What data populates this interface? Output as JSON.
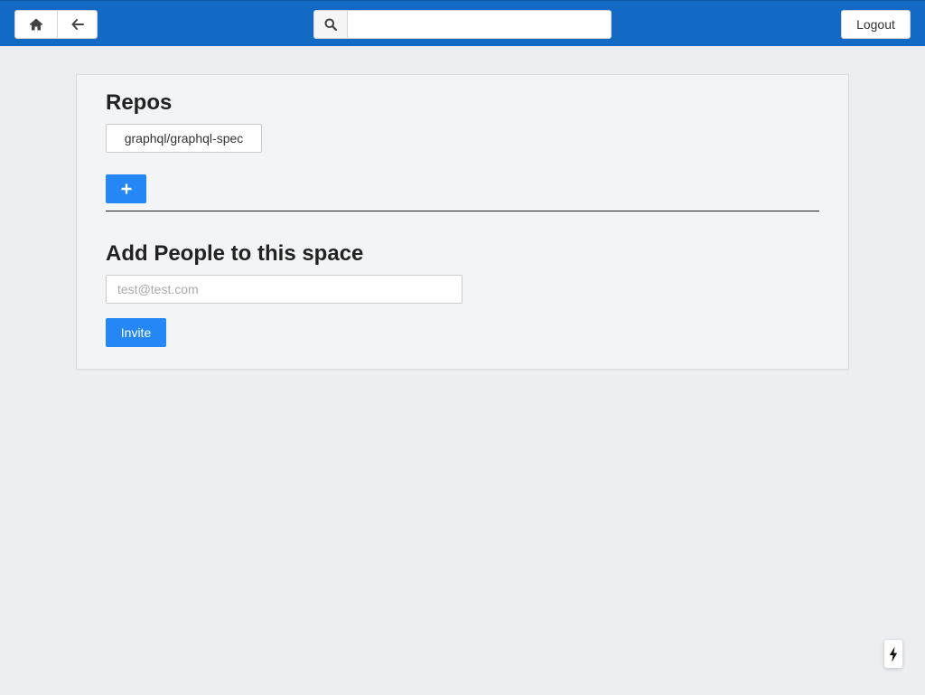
{
  "header": {
    "home_icon": "home-icon",
    "back_icon": "arrow-left-icon",
    "search_icon": "search-icon",
    "search_value": "",
    "logout_label": "Logout",
    "background_color": "#136ac4"
  },
  "repos": {
    "title": "Repos",
    "items": [
      {
        "label": "graphql/graphql-spec"
      }
    ],
    "add_icon": "plus-icon"
  },
  "people": {
    "title": "Add People to this space",
    "email_placeholder": "test@test.com",
    "email_value": "",
    "invite_label": "Invite"
  },
  "floating": {
    "icon": "lightning-bolt-icon"
  },
  "colors": {
    "primary": "#2487f5",
    "page_background": "#edeef2",
    "card_background": "#f3f4f6"
  }
}
